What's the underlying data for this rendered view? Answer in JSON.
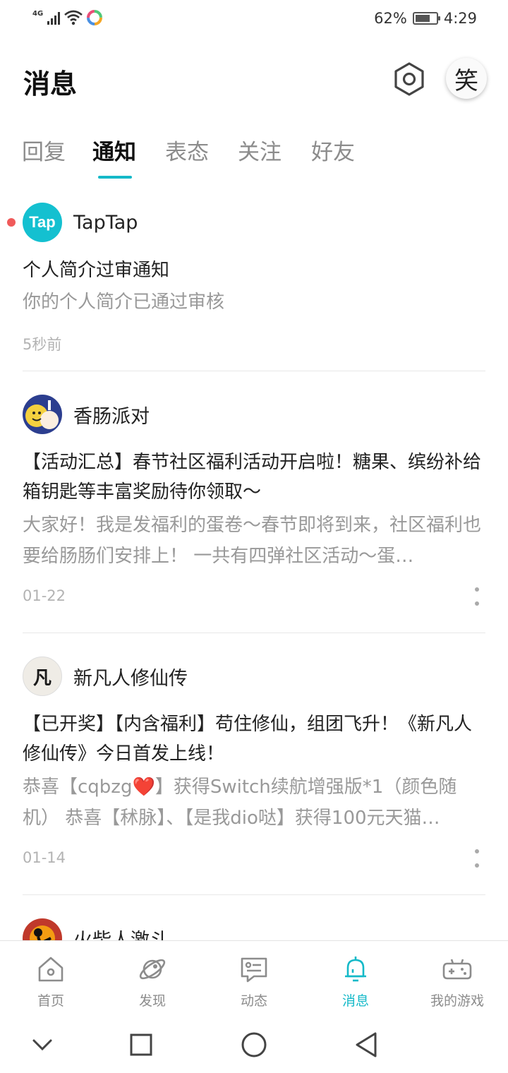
{
  "status_bar": {
    "network": "4G",
    "battery_percent": "62%",
    "time": "4:29"
  },
  "header": {
    "title": "消息",
    "avatar_char": "笑"
  },
  "tabs": [
    {
      "label": "回复"
    },
    {
      "label": "通知"
    },
    {
      "label": "表态"
    },
    {
      "label": "关注"
    },
    {
      "label": "好友"
    }
  ],
  "active_tab": "通知",
  "notifications": [
    {
      "name": "TapTap",
      "logo_text": "Tap",
      "unread": true,
      "title": "个人简介过审通知",
      "body": "你的个人简介已通过审核",
      "time": "5秒前"
    },
    {
      "name": "香肠派对",
      "title": "【活动汇总】春节社区福利活动开启啦！糖果、缤纷补给箱钥匙等丰富奖励待你领取～",
      "body": "大家好！我是发福利的蛋卷～春节即将到来，社区福利也要给肠肠们安排上！ 一共有四弹社区活动～蛋…",
      "time": "01-22"
    },
    {
      "name": "新凡人修仙传",
      "avatar_text": "凡",
      "title": "【已开奖】【内含福利】苟住修仙，组团飞升！《新凡人修仙传》今日首发上线！",
      "body": "恭喜【cqbzg❤️】获得Switch续航增强版*1（颜色随机） 恭喜【秫脉】、【是我dio哒】获得100元天猫…",
      "time": "01-14"
    },
    {
      "name": "火柴人激斗"
    }
  ],
  "bottom_nav": [
    {
      "label": "首页",
      "icon": "home-icon"
    },
    {
      "label": "发现",
      "icon": "planet-icon"
    },
    {
      "label": "动态",
      "icon": "feed-icon"
    },
    {
      "label": "消息",
      "icon": "bell-icon"
    },
    {
      "label": "我的游戏",
      "icon": "gamepad-icon"
    }
  ],
  "accent_color": "#14b9c8",
  "unread_color": "#f05a5a"
}
